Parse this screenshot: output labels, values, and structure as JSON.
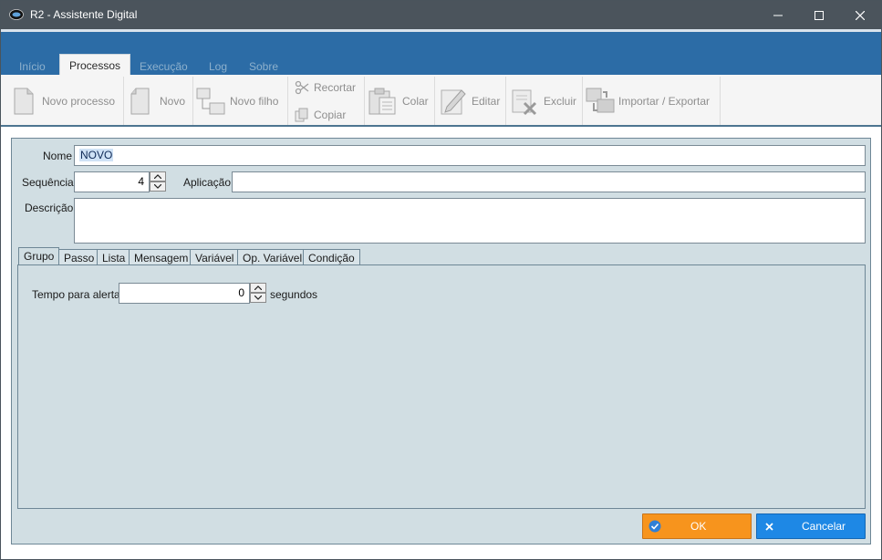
{
  "window": {
    "title": "R2 - Assistente Digital"
  },
  "ribbon_tabs": [
    {
      "label": "Início"
    },
    {
      "label": "Processos"
    },
    {
      "label": "Execução"
    },
    {
      "label": "Log"
    },
    {
      "label": "Sobre"
    }
  ],
  "toolbar": {
    "novo_processo": "Novo processo",
    "novo": "Novo",
    "novo_filho": "Novo filho",
    "recortar": "Recortar",
    "copiar": "Copiar",
    "colar": "Colar",
    "editar": "Editar",
    "excluir": "Excluir",
    "importar_exportar": "Importar / Exportar"
  },
  "form": {
    "nome_label": "Nome",
    "nome_value": "NOVO",
    "sequencia_label": "Sequência",
    "sequencia_value": "4",
    "aplicacao_label": "Aplicação",
    "aplicacao_value": "",
    "descricao_label": "Descrição",
    "descricao_value": ""
  },
  "inner_tabs": [
    {
      "label": "Grupo"
    },
    {
      "label": "Passo"
    },
    {
      "label": "Lista"
    },
    {
      "label": "Mensagem"
    },
    {
      "label": "Variável"
    },
    {
      "label": "Op. Variável"
    },
    {
      "label": "Condição"
    }
  ],
  "grupo": {
    "tempo_label": "Tempo para alerta",
    "tempo_value": "0",
    "unit": "segundos"
  },
  "footer": {
    "ok": "OK",
    "cancelar": "Cancelar"
  },
  "colors": {
    "ribbon": "#2c6ca6",
    "panel": "#d1dee3",
    "ok": "#f7941d",
    "cancel": "#1e88e5",
    "titlebar": "#4b545c"
  }
}
